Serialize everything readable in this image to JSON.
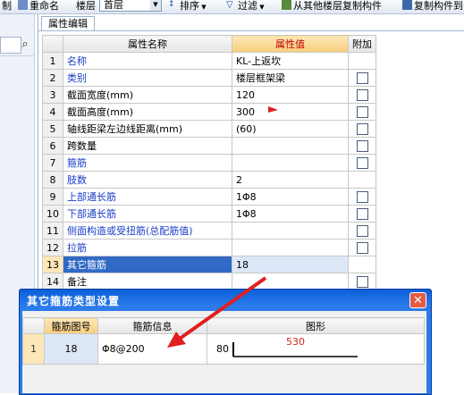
{
  "toolbar": {
    "item_1": "制",
    "rename": "重命名",
    "floor_label": "楼层",
    "floor_value": "首层",
    "sort": "排序",
    "filter": "过滤",
    "copy_from_other_floor": "从其他楼层复制构件",
    "copy_component_to": "复制构件到"
  },
  "panel": {
    "tab_label": "属性编辑"
  },
  "properties": {
    "headers": {
      "name": "属性名称",
      "value": "属性值",
      "extra": "附加"
    },
    "rows": [
      {
        "num": "1",
        "name": "名称",
        "value": "KL-上返坎",
        "checkbox": false
      },
      {
        "num": "2",
        "name": "类别",
        "value": "楼层框架梁",
        "checkbox": true
      },
      {
        "num": "3",
        "name": "截面宽度(mm)",
        "value": "120",
        "checkbox": true
      },
      {
        "num": "4",
        "name": "截面高度(mm)",
        "value": "300",
        "checkbox": true
      },
      {
        "num": "5",
        "name": "轴线距梁左边线距离(mm)",
        "value": "(60)",
        "checkbox": true
      },
      {
        "num": "6",
        "name": "跨数量",
        "value": "",
        "checkbox": true
      },
      {
        "num": "7",
        "name": "箍筋",
        "value": "",
        "checkbox": true
      },
      {
        "num": "8",
        "name": "肢数",
        "value": "2",
        "checkbox": false
      },
      {
        "num": "9",
        "name": "上部通长筋",
        "value": "1Φ8",
        "checkbox": true
      },
      {
        "num": "10",
        "name": "下部通长筋",
        "value": "1Φ8",
        "checkbox": true
      },
      {
        "num": "11",
        "name": "侧面构造或受扭筋(总配筋值)",
        "value": "",
        "checkbox": true
      },
      {
        "num": "12",
        "name": "拉筋",
        "value": "",
        "checkbox": true
      },
      {
        "num": "13",
        "name": "其它箍筋",
        "value": "18",
        "checkbox": false
      },
      {
        "num": "14",
        "name": "备注",
        "value": "",
        "checkbox": true
      }
    ]
  },
  "dialog": {
    "title": "其它箍筋类型设置",
    "headers": {
      "shape_no": "箍筋图号",
      "info": "箍筋信息",
      "shape": "图形"
    },
    "rows": [
      {
        "num": "1",
        "shape_no": "18",
        "info": "Φ8@200",
        "dim_left": "80",
        "dim_top": "530"
      }
    ]
  },
  "colors": {
    "accent_blue": "#1a3dc8",
    "selection": "#316ac5",
    "header_highlight": "#f8cf7c",
    "arrow": "#e02020"
  }
}
